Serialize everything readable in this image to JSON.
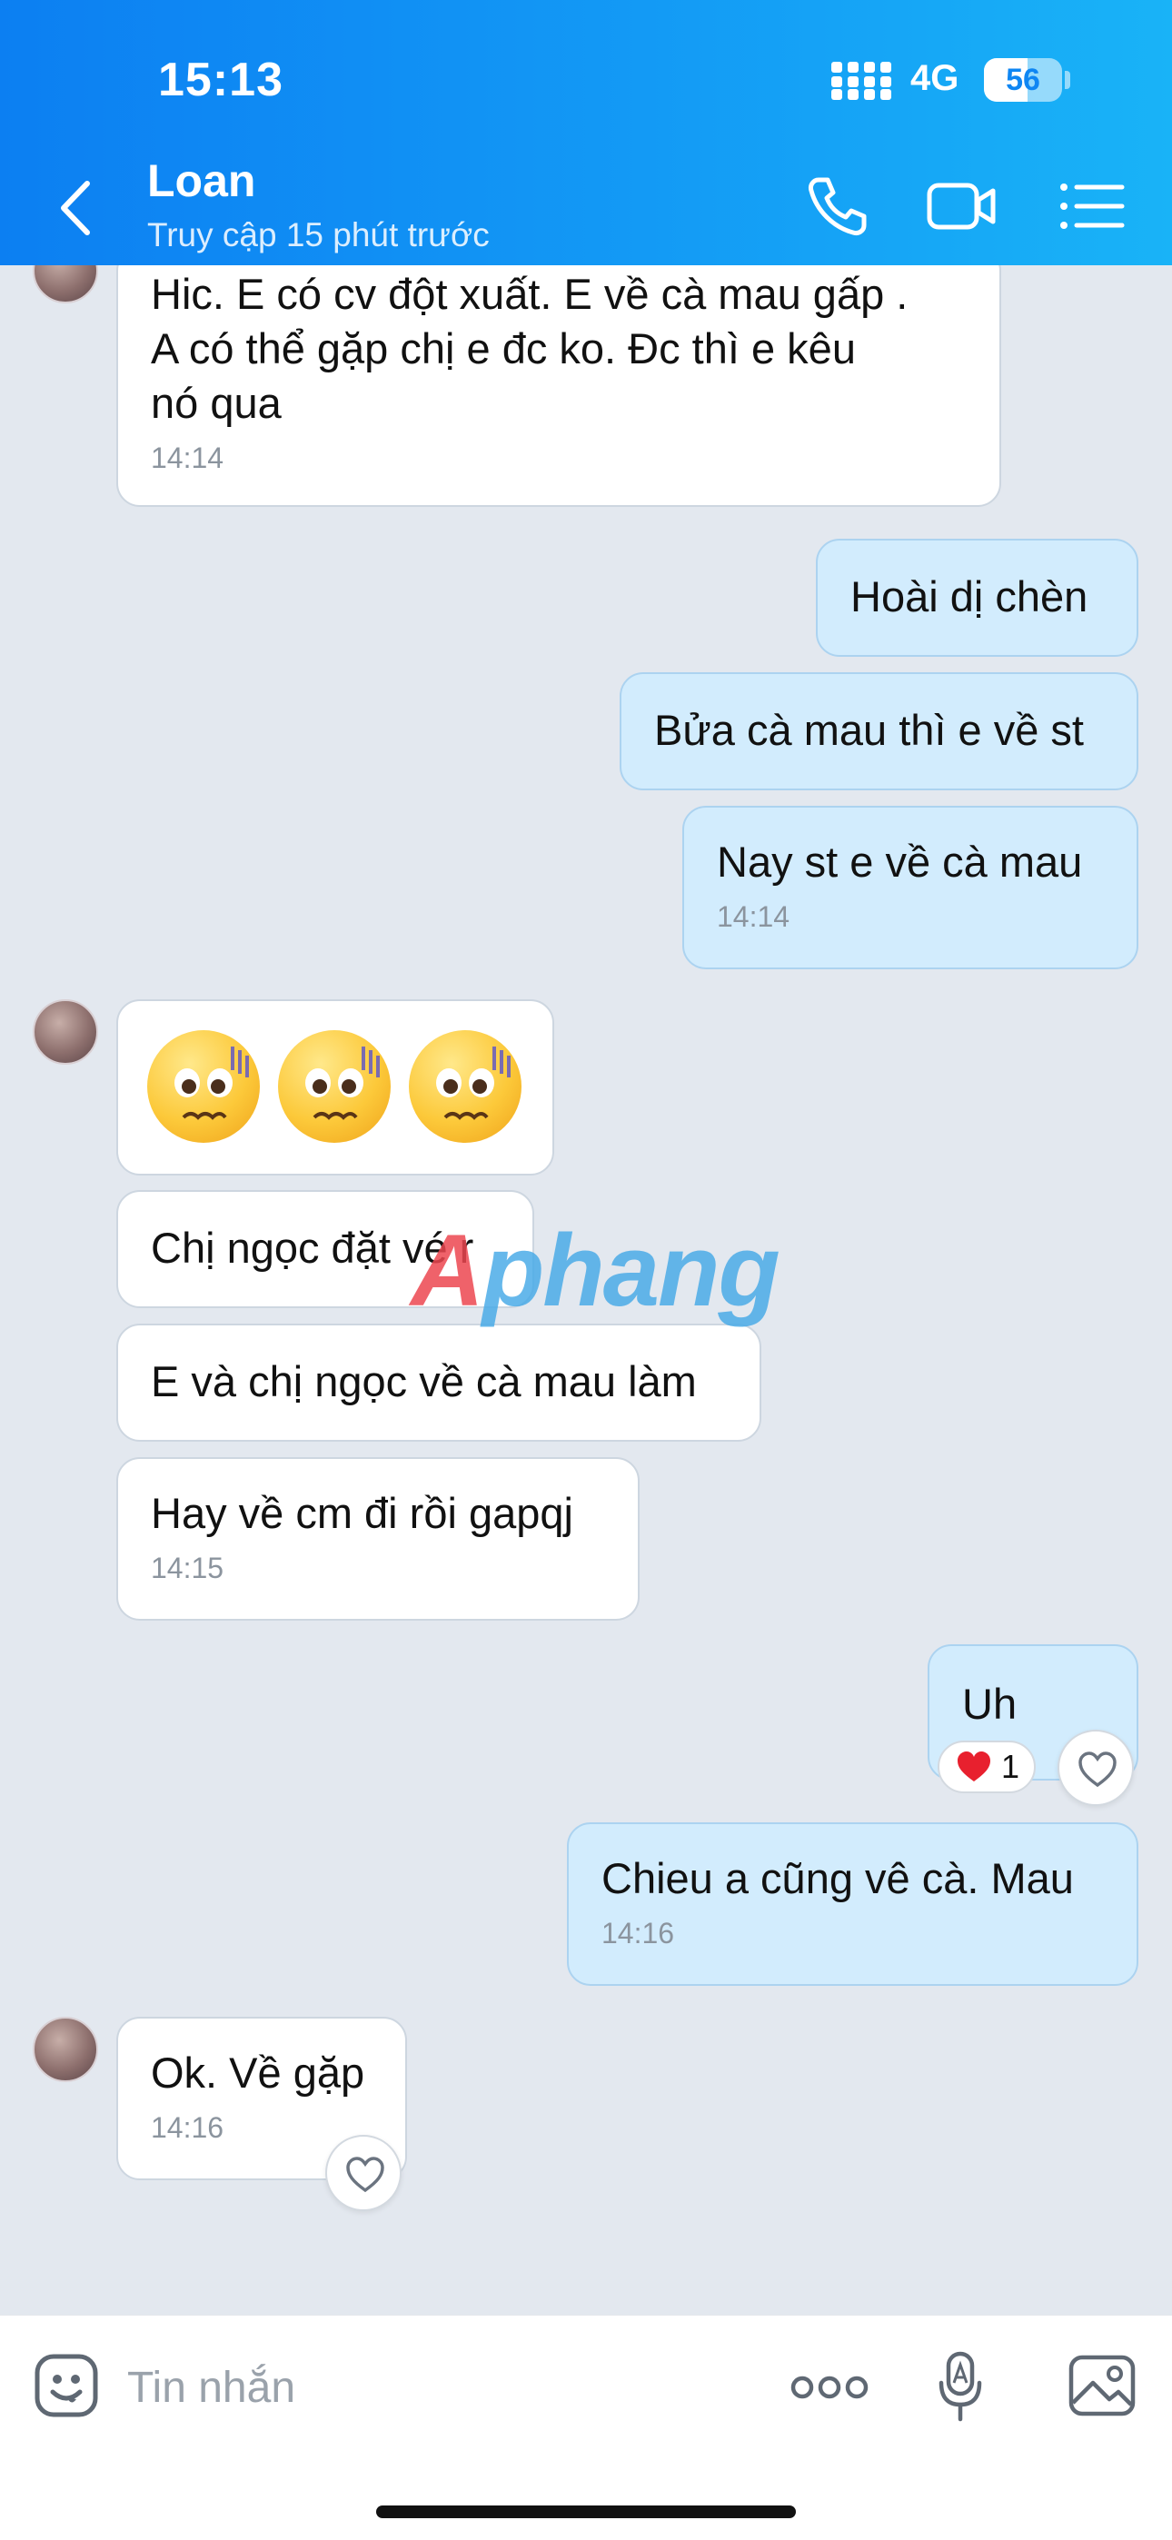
{
  "status_bar": {
    "time": "15:13",
    "network": "4G",
    "battery": "56",
    "battery_level": 0.56
  },
  "header": {
    "contact_name": "Loan",
    "contact_status": "Truy cập 15 phút trước",
    "icons": [
      "back-chevron-icon",
      "phone-icon",
      "video-icon",
      "menu-list-icon"
    ]
  },
  "messages": [
    {
      "from": "contact",
      "text": "Hic. E có cv đột xuất. E về cà mau gấp .\nA có thể gặp chị e đc ko. Đc thì e kêu\nnó qua",
      "time": "14:14"
    },
    {
      "from": "me",
      "text": "Hoài dị chèn"
    },
    {
      "from": "me",
      "text": "Bửa cà mau thì e về st"
    },
    {
      "from": "me",
      "text": "Nay st e về cà mau",
      "time": "14:14"
    },
    {
      "from": "contact",
      "emoji": "worried-face-emoji",
      "emoji_count": 3
    },
    {
      "from": "contact",
      "text": "Chị ngọc đặt vé r"
    },
    {
      "from": "contact",
      "text": "E và chị ngọc về cà mau làm"
    },
    {
      "from": "contact",
      "text": "Hay về cm đi rồi gapqj",
      "time": "14:15"
    },
    {
      "from": "me",
      "text": "Uh",
      "reaction": {
        "icon": "heart-icon",
        "count": "1"
      }
    },
    {
      "from": "me",
      "text": "Chieu a cũng vê cà. Mau",
      "time": "14:16"
    },
    {
      "from": "contact",
      "text": "Ok. Về gặp",
      "time": "14:16"
    }
  ],
  "watermark": {
    "prefix": "A",
    "rest": "phang"
  },
  "input_bar": {
    "placeholder": "Tin nhắn",
    "icons": [
      "sticker-icon",
      "more-options-icon",
      "voice-text-mic-icon",
      "image-icon"
    ]
  },
  "colors": {
    "header_gradient_start": "#0c7ff2",
    "header_gradient_end": "#19b3f7",
    "chat_background": "#e3e8ef",
    "incoming_bubble": "#ffffff",
    "outgoing_bubble": "#d2ecfd",
    "heart": "#e8202e"
  }
}
